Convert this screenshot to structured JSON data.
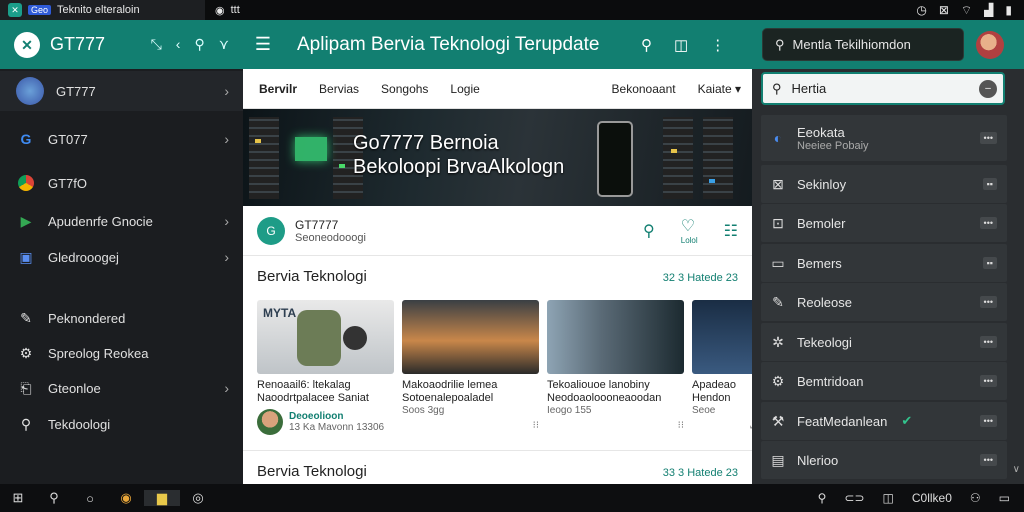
{
  "top_strip": {
    "tab1_badge": "Geo",
    "tab1_title": "Teknito elteraloin",
    "tab2_title": "ttt"
  },
  "appbar": {
    "brand": "GT777",
    "title": "Aplipam Bervia Teknologi Terupdate",
    "search_placeholder": "Mentla Tekilhiomdon"
  },
  "sidebar": {
    "items": [
      {
        "label": "GT777",
        "icon": "avatar-icon",
        "chevron": true,
        "active": true
      },
      {
        "label": "GT077",
        "icon": "g-logo-icon",
        "chevron": true
      },
      {
        "label": "GT7fO",
        "icon": "chrome-icon",
        "chevron": false
      },
      {
        "label": "Apudenrfe Gnocie",
        "icon": "play-store-icon",
        "chevron": true
      },
      {
        "label": "Gledrooogej",
        "icon": "folder-icon",
        "chevron": true
      },
      {
        "label": "Peknondered",
        "icon": "edit-icon",
        "chevron": false
      },
      {
        "label": "Spreolog Reokea",
        "icon": "settings-icon",
        "chevron": false
      },
      {
        "label": "Gteonloe",
        "icon": "share-icon",
        "chevron": true
      },
      {
        "label": "Tekdoologi",
        "icon": "search-icon",
        "chevron": false
      }
    ]
  },
  "subnav": {
    "items": [
      "Bervilr",
      "Bervias",
      "Songohs",
      "Logie"
    ],
    "right": [
      "Bekonoaant",
      "Kaiate"
    ]
  },
  "hero": {
    "line1": "Go7777 Bernoia",
    "line2": "Bekoloopi BrvaAlkologn"
  },
  "channel": {
    "avatar_text": "G",
    "name": "GT7777",
    "sub": "Seoneodooogi",
    "follow_label": "Lolol"
  },
  "section1": {
    "title": "Bervia Teknologi",
    "link": "32 3 Hatede 23",
    "cards": [
      {
        "thumb_text": "MYTA",
        "title": "Renoaail6: ltekalag",
        "title2": "Naoodrtpalacee Saniat",
        "channel": "Deoeolioon",
        "meta": "13 Ka Mavonn 13306"
      },
      {
        "title": "Makoaodrilie lemea",
        "title2": "Sotoenalepoaladel",
        "meta": "Soos 3gg"
      },
      {
        "title": "Tekoaliouoe lanobiny",
        "title2": "Neodoaoloooneaoodan",
        "meta": "Ieogo 155"
      },
      {
        "title": "Apadeao",
        "title2": "Hendon",
        "meta": "Seoe"
      }
    ]
  },
  "section2": {
    "title": "Bervia Teknologi",
    "link": "33 3 Hatede 23"
  },
  "right_panel": {
    "search_value": "Hertia",
    "items": [
      {
        "label": "Eeokata",
        "sub": "Neeiee Pobaiy",
        "icon": "google-icon"
      },
      {
        "label": "Sekinloy",
        "icon": "image-icon"
      },
      {
        "label": "Bemoler",
        "icon": "archive-icon"
      },
      {
        "label": "Bemers",
        "icon": "window-icon"
      },
      {
        "label": "Reoleose",
        "icon": "edit-icon"
      },
      {
        "label": "Tekeologi",
        "icon": "gear-icon"
      },
      {
        "label": "Bemtridoan",
        "icon": "settings-icon"
      },
      {
        "label": "FeatMedanlean",
        "icon": "wrench-icon",
        "check": true
      },
      {
        "label": "Nlerioo",
        "icon": "document-icon"
      }
    ]
  },
  "taskbar": {
    "right_text": "C0llke0"
  },
  "colors": {
    "accent": "#127f71",
    "sidebar_bg": "#1b1d20",
    "panel_bg": "#2a2d30"
  }
}
